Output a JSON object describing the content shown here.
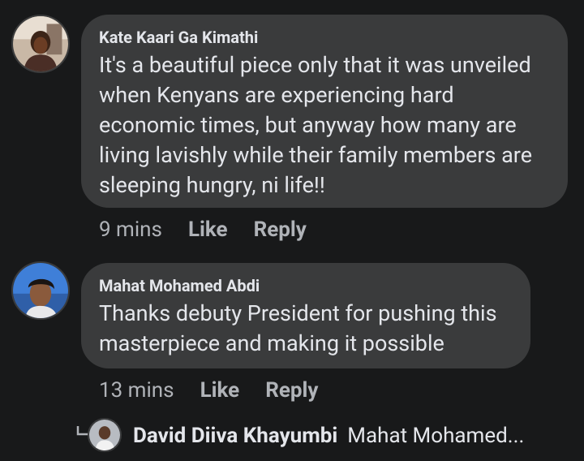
{
  "comments": [
    {
      "author": "Kate Kaari Ga Kimathi",
      "text": "It's a beautiful piece only that it was unveiled when Kenyans are experiencing hard economic times, but anyway how many are living lavishly while their family members are sleeping hungry, ni life!!",
      "time": "9 mins",
      "like_label": "Like",
      "reply_label": "Reply"
    },
    {
      "author": "Mahat Mohamed Abdi",
      "text": "Thanks debuty President for pushing this masterpiece and making it possible",
      "time": "13 mins",
      "like_label": "Like",
      "reply_label": "Reply"
    }
  ],
  "reply_preview": {
    "author": "David Diiva Khayumbi",
    "text": "Mahat Mohamed..."
  },
  "colors": {
    "background": "#18191a",
    "bubble": "#3a3b3c",
    "primary_text": "#e4e6eb",
    "secondary_text": "#b0b3b8"
  }
}
